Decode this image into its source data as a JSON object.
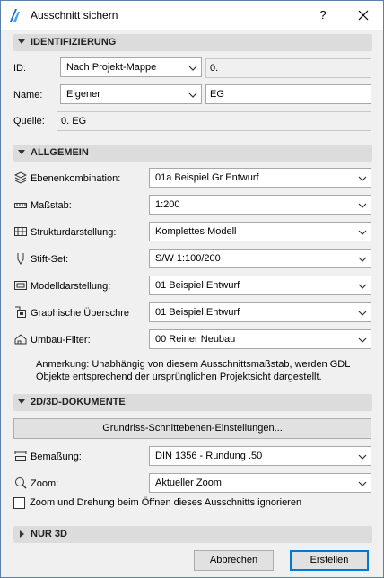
{
  "window": {
    "title": "Ausschnitt sichern",
    "help": "?"
  },
  "sections": {
    "identifizierung": "IDENTIFIZIERUNG",
    "allgemein": "ALLGEMEIN",
    "dokumente": "2D/3D-DOKUMENTE",
    "nur3d": "NUR 3D"
  },
  "identifizierung": {
    "id_label": "ID:",
    "id_mode": "Nach Projekt-Mappe",
    "id_value": "0.",
    "name_label": "Name:",
    "name_mode": "Eigener",
    "name_value": "EG",
    "source_label": "Quelle:",
    "source_value": "0. EG"
  },
  "allgemein": {
    "rows": [
      {
        "label": "Ebenenkombination:",
        "value": "01a Beispiel Gr Entwurf",
        "icon": "layers-icon"
      },
      {
        "label": "Maßstab:",
        "value": "1:200",
        "icon": "ruler-icon"
      },
      {
        "label": "Strukturdarstellung:",
        "value": "Komplettes Modell",
        "icon": "structure-icon"
      },
      {
        "label": "Stift-Set:",
        "value": "S/W 1:100/200",
        "icon": "pen-icon"
      },
      {
        "label": "Modelldarstellung:",
        "value": "01 Beispiel Entwurf",
        "icon": "model-view-icon"
      },
      {
        "label": "Graphische Überschre",
        "value": "01 Beispiel Entwurf",
        "icon": "graphic-override-icon"
      },
      {
        "label": "Umbau-Filter:",
        "value": "00 Reiner Neubau",
        "icon": "renovation-filter-icon"
      }
    ],
    "note": "Anmerkung: Unabhängig von diesem Ausschnittsmaßstab, werden GDL Objekte entsprechend der ursprünglichen Projektsicht dargestellt."
  },
  "dokumente": {
    "settings_button": "Grundriss-Schnittebenen-Einstellungen...",
    "dim_label": "Bemaßung:",
    "dim_value": "DIN 1356 - Rundung .50",
    "zoom_label": "Zoom:",
    "zoom_value": "Aktueller Zoom",
    "ignore_label": "Zoom und Drehung beim Öffnen dieses Ausschnitts ignorieren",
    "ignore_checked": false
  },
  "footer": {
    "cancel": "Abbrechen",
    "create": "Erstellen"
  },
  "colors": {
    "section_bg": "#dcdcdc",
    "window_bg": "#f0f0f0",
    "default_border": "#0078d7"
  }
}
